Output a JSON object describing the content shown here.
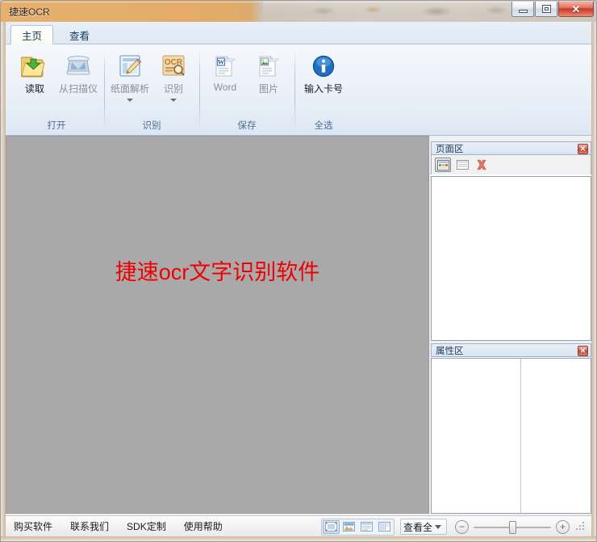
{
  "window": {
    "title": "捷速OCR",
    "buttons": {
      "minimize": "minimize",
      "maximize": "maximize",
      "close": "✕"
    }
  },
  "ribbon": {
    "tabs": [
      {
        "label": "主页",
        "active": true
      },
      {
        "label": "查看",
        "active": false
      }
    ],
    "groups": [
      {
        "label": "打开",
        "items": [
          {
            "label": "读取",
            "icon": "open-folder-icon",
            "enabled": true,
            "dropdown": false
          },
          {
            "label": "从扫描仪",
            "icon": "scanner-icon",
            "enabled": false,
            "dropdown": false
          }
        ]
      },
      {
        "label": "识别",
        "items": [
          {
            "label": "纸面解析",
            "icon": "page-analysis-icon",
            "enabled": false,
            "dropdown": true
          },
          {
            "label": "识别",
            "icon": "ocr-icon",
            "enabled": false,
            "dropdown": true
          }
        ]
      },
      {
        "label": "保存",
        "items": [
          {
            "label": "Word",
            "icon": "word-doc-icon",
            "enabled": false,
            "dropdown": false
          },
          {
            "label": "图片",
            "icon": "image-doc-icon",
            "enabled": false,
            "dropdown": false
          }
        ]
      },
      {
        "label": "全选",
        "items": [
          {
            "label": "输入卡号",
            "icon": "info-circle-icon",
            "enabled": true,
            "dropdown": false
          }
        ]
      }
    ]
  },
  "canvas": {
    "watermark": "捷速ocr文字识别软件",
    "watermark_color": "#f00000",
    "background_color": "#a9a9a9"
  },
  "pages_panel": {
    "title": "页面区",
    "close_glyph": "✕",
    "toolbar": [
      {
        "name": "thumbnail-view-button",
        "selected": true
      },
      {
        "name": "list-view-button",
        "selected": false
      },
      {
        "name": "delete-page-button",
        "selected": false
      }
    ]
  },
  "props_panel": {
    "title": "属性区",
    "close_glyph": "✕"
  },
  "statusbar": {
    "links": [
      "购买软件",
      "联系我们",
      "SDK定制",
      "使用帮助"
    ],
    "view_buttons": [
      {
        "name": "view-mode-single",
        "selected": true
      },
      {
        "name": "view-mode-image",
        "selected": false
      },
      {
        "name": "view-mode-text",
        "selected": false
      },
      {
        "name": "view-mode-split",
        "selected": false
      }
    ],
    "view_select": "查看全",
    "zoom_out": "−",
    "zoom_in": "+",
    "zoom_value": "45"
  }
}
